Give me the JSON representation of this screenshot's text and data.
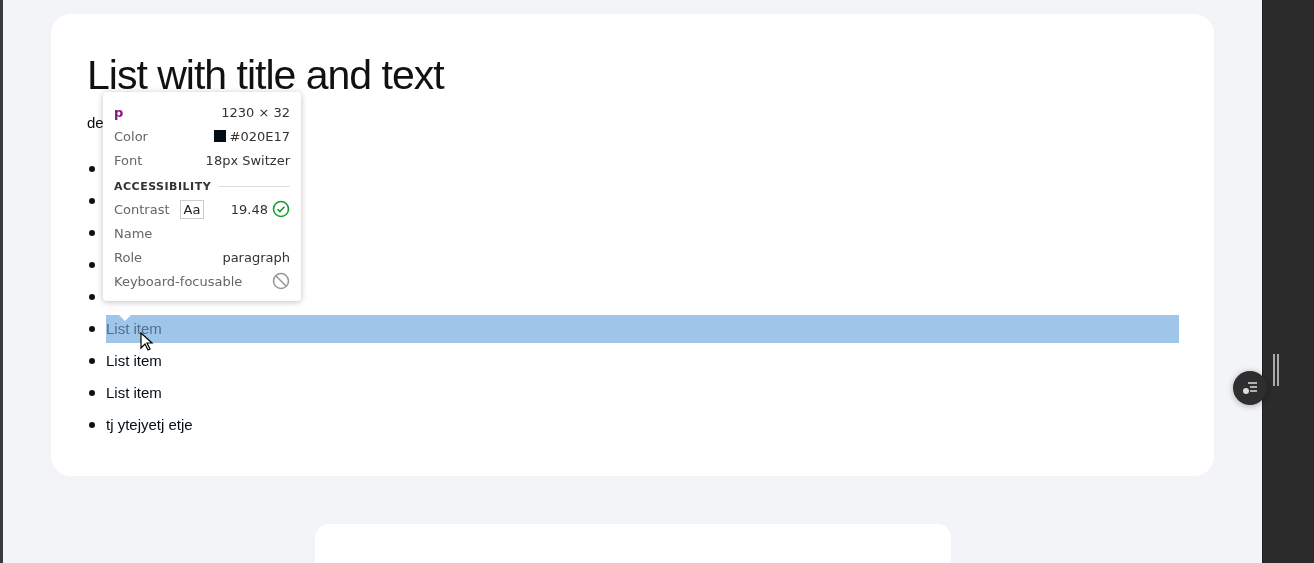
{
  "card": {
    "title": "List with title and text",
    "description": "de",
    "items": [
      {
        "kind": "covered"
      },
      {
        "kind": "covered"
      },
      {
        "kind": "covered"
      },
      {
        "kind": "covered"
      },
      {
        "kind": "covered"
      },
      {
        "kind": "text",
        "text": "List item",
        "selected": true
      },
      {
        "kind": "text",
        "text": "List item",
        "selected": false
      },
      {
        "kind": "text",
        "text": "List item",
        "selected": false
      },
      {
        "kind": "text",
        "text": "tj ytejyetj etje",
        "selected": false
      }
    ]
  },
  "inspector_tooltip": {
    "tag": "p",
    "size": "1230 × 32",
    "rows": [
      {
        "kind": "color",
        "label": "Color",
        "value": "#020E17",
        "color": "#020e17"
      },
      {
        "kind": "text",
        "label": "Font",
        "value": "18px Switzer"
      }
    ],
    "section": "ACCESSIBILITY",
    "a11y_rows": [
      {
        "kind": "contrast",
        "label": "Contrast",
        "sample": "Aa",
        "value": "19.48",
        "passed": true
      },
      {
        "kind": "text",
        "label": "Name"
      },
      {
        "kind": "text",
        "label": "Role",
        "value": "paragraph"
      },
      {
        "kind": "focusable",
        "label": "Keyboard-focusable",
        "focusable": false
      }
    ]
  }
}
